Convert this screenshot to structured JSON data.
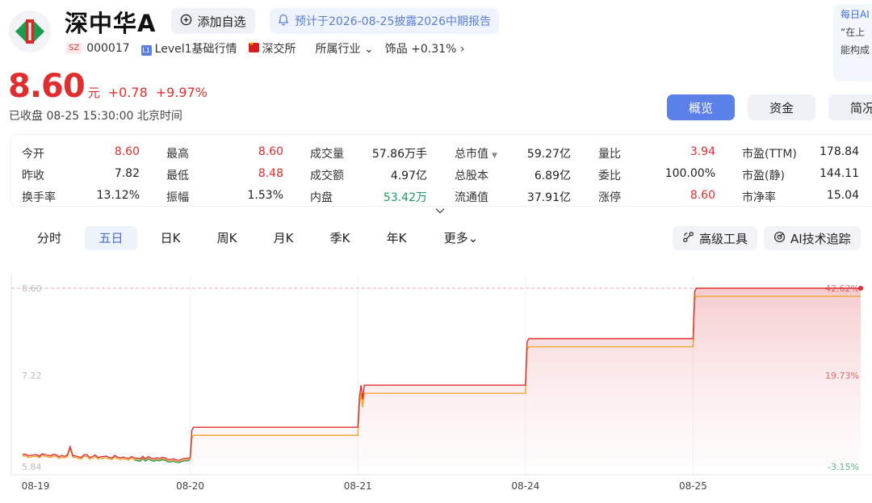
{
  "header": {
    "stock_name": "深中华A",
    "watch_button": "添加自选",
    "report_notice": "预计于2026-08-25披露2026中期报告",
    "ai_panel": {
      "title": "每日AI",
      "line1": "“在上",
      "line2": "能构成"
    }
  },
  "subinfo": {
    "exchange_tag": "SZ",
    "code": "000017",
    "level_tag": "L1",
    "level": "Level1基础行情",
    "exchange": "深交所",
    "industry_label": "所属行业",
    "industry_name": "饰品",
    "industry_change": "+0.31%"
  },
  "quote": {
    "price": "8.60",
    "unit": "元",
    "change": "+0.78",
    "change_pct": "+9.97%",
    "status": "已收盘 08-25 15:30:00 北京时间"
  },
  "main_tabs": [
    "概览",
    "资金",
    "简况"
  ],
  "stats": [
    {
      "label": "今开",
      "value": "8.60",
      "color": "red"
    },
    {
      "label": "最高",
      "value": "8.60",
      "color": "red"
    },
    {
      "label": "成交量",
      "value": "57.86万手",
      "color": "dark"
    },
    {
      "label": "总市值",
      "value": "59.27亿",
      "color": "dark"
    },
    {
      "label": "量比",
      "value": "3.94",
      "color": "red"
    },
    {
      "label": "市盈(TTM)",
      "value": "178.84",
      "color": "dark"
    },
    {
      "label": "昨收",
      "value": "7.82",
      "color": "dark"
    },
    {
      "label": "最低",
      "value": "8.48",
      "color": "red"
    },
    {
      "label": "成交额",
      "value": "4.97亿",
      "color": "dark"
    },
    {
      "label": "总股本",
      "value": "6.89亿",
      "color": "dark"
    },
    {
      "label": "委比",
      "value": "100.00%",
      "color": "dark"
    },
    {
      "label": "市盈(静)",
      "value": "144.11",
      "color": "dark"
    },
    {
      "label": "换手率",
      "value": "13.12%",
      "color": "dark"
    },
    {
      "label": "振幅",
      "value": "1.53%",
      "color": "dark"
    },
    {
      "label": "内盘",
      "value": "53.42万",
      "color": "green"
    },
    {
      "label": "流通值",
      "value": "37.91亿",
      "color": "dark"
    },
    {
      "label": "涨停",
      "value": "8.60",
      "color": "red"
    },
    {
      "label": "市净率",
      "value": "15.04",
      "color": "dark"
    }
  ],
  "period_tabs": [
    "分时",
    "五日",
    "日K",
    "周K",
    "月K",
    "季K",
    "年K",
    "更多"
  ],
  "active_period": "五日",
  "tools": {
    "advanced": "高级工具",
    "ai_tracking": "AI技术追踪"
  },
  "colors": {
    "up": "#e02e2e",
    "down": "#1a9a5a",
    "accent": "#5b80e8",
    "avg_line": "#f0a020"
  },
  "chart_data": {
    "type": "line",
    "x": [
      "08-19",
      "08-20",
      "08-21",
      "08-24",
      "08-25"
    ],
    "y_left_ticks": [
      "8.60",
      "7.22",
      "5.84"
    ],
    "y_right_ticks": [
      "42.62%",
      "19.73%",
      "-3.15%"
    ],
    "ylim": [
      5.84,
      8.6
    ],
    "series": [
      {
        "values": [
          6.03,
          6.45,
          7.1,
          7.82,
          8.6
        ]
      }
    ]
  }
}
